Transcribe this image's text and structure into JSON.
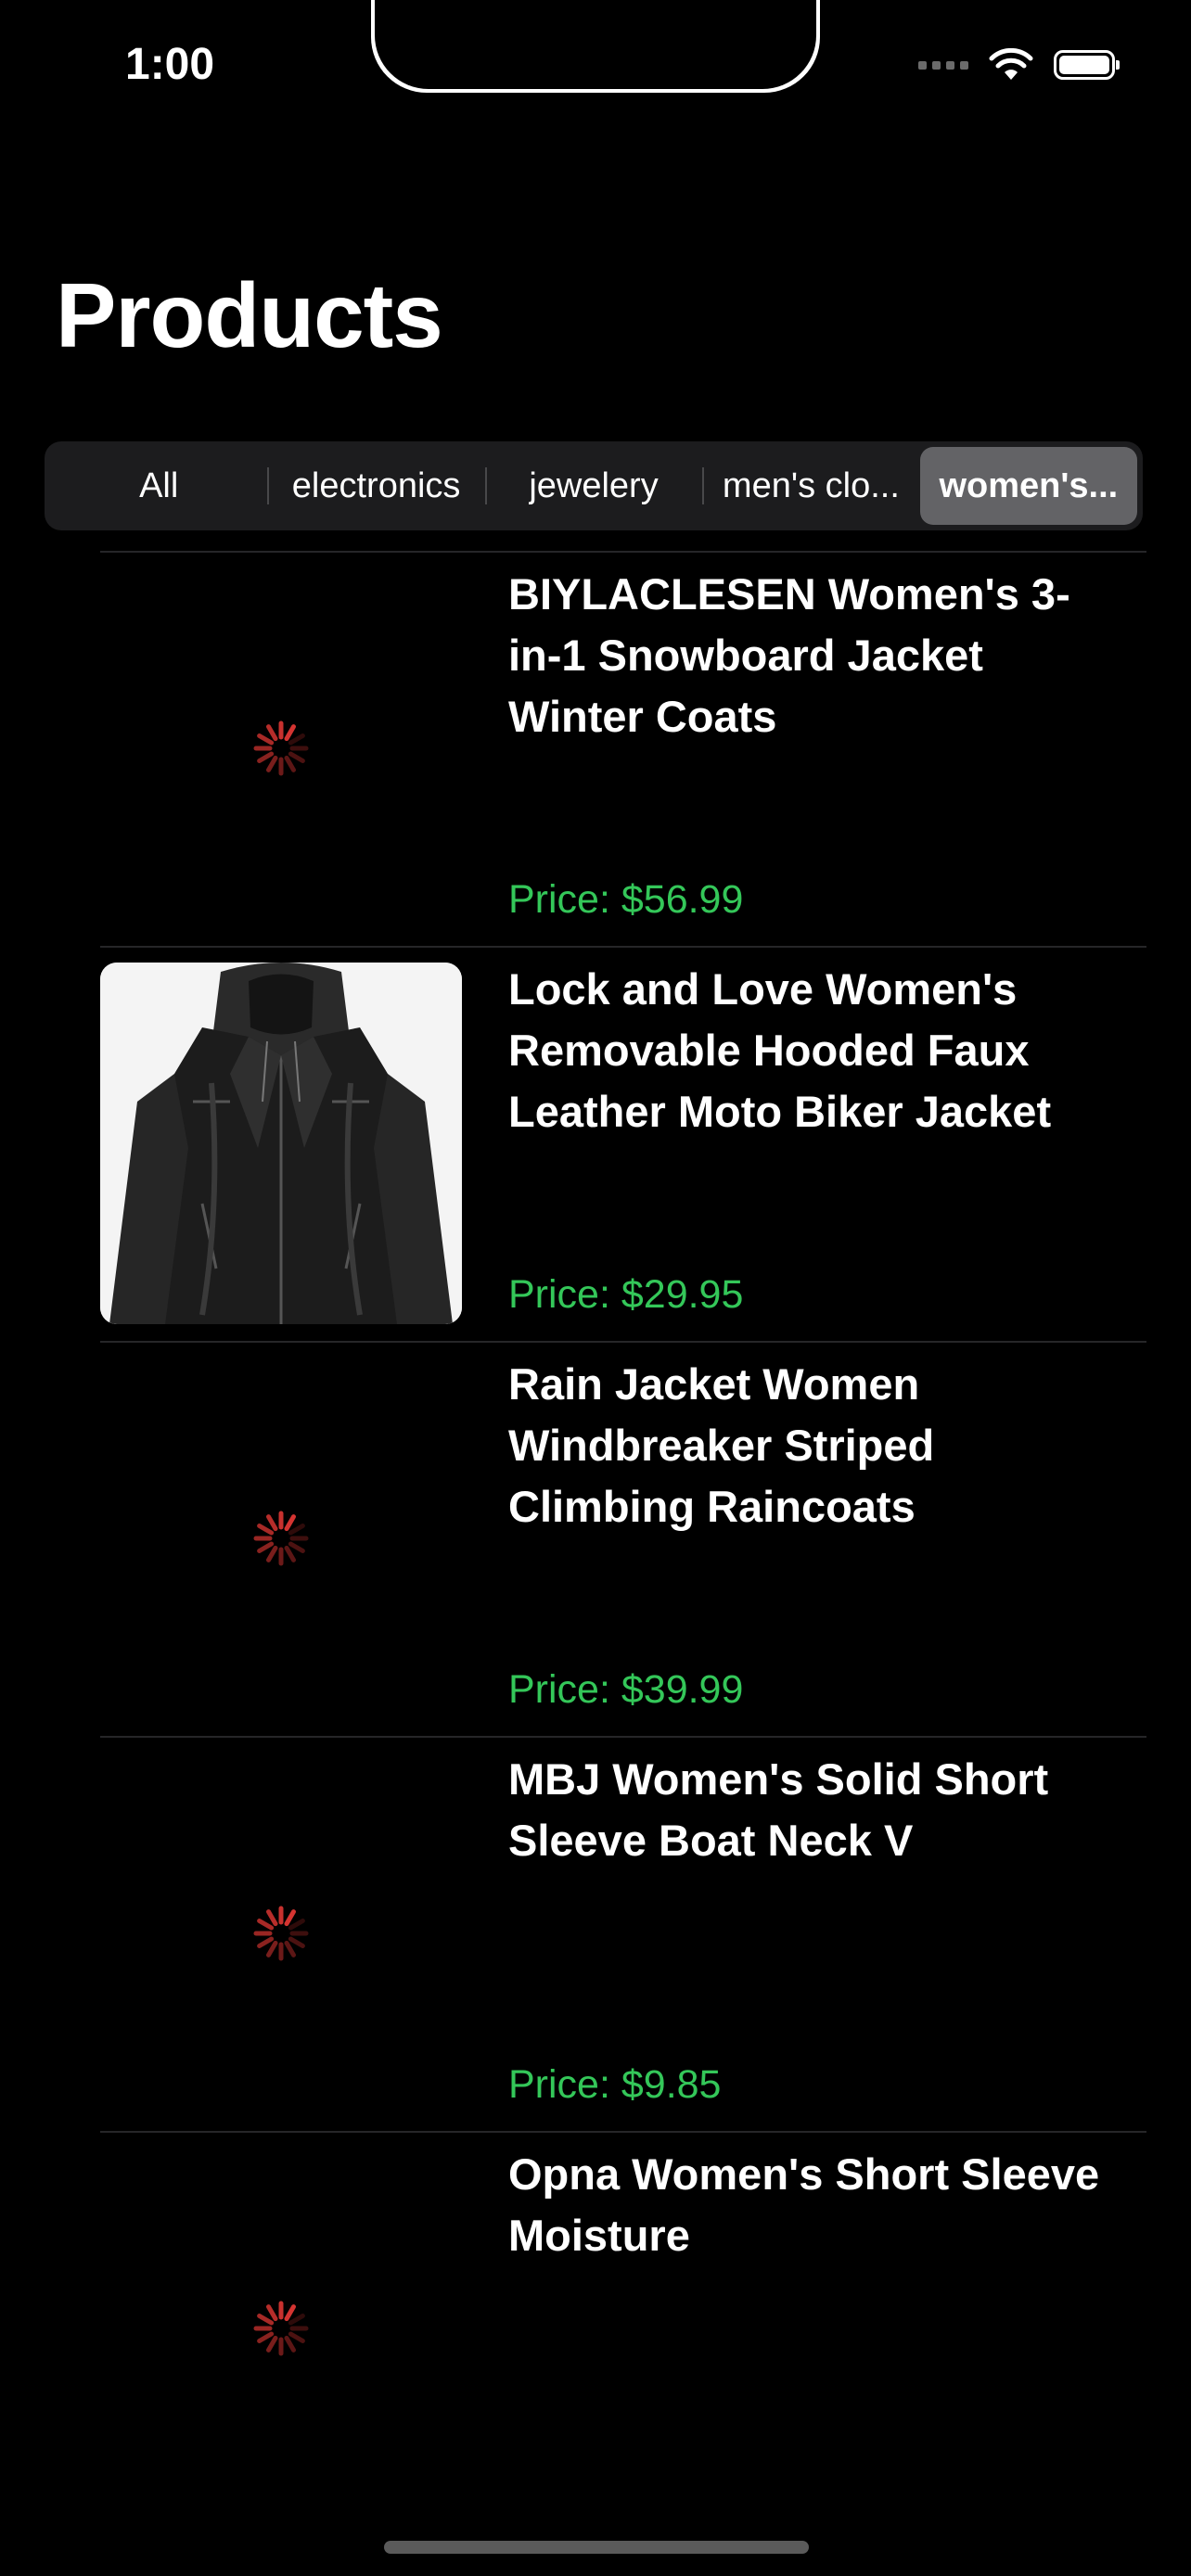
{
  "status_bar": {
    "time": "1:00"
  },
  "header": {
    "title": "Products"
  },
  "categories": {
    "selected_index": 4,
    "items": [
      {
        "label": "All"
      },
      {
        "label": "electronics"
      },
      {
        "label": "jewelery"
      },
      {
        "label": "men's clo..."
      },
      {
        "label": "women's..."
      }
    ]
  },
  "products": [
    {
      "title": "BIYLACLESEN Women's 3-in-1 Snowboard Jacket Winter Coats",
      "price": "Price: $56.99",
      "image": "loading-spinner"
    },
    {
      "title": "Lock and Love Women's Removable Hooded Faux Leather Moto Biker Jacket",
      "price": "Price: $29.95",
      "image": "black-leather-jacket"
    },
    {
      "title": "Rain Jacket Women Windbreaker Striped Climbing Raincoats",
      "price": "Price: $39.99",
      "image": "loading-spinner"
    },
    {
      "title": "MBJ Women's Solid Short Sleeve Boat Neck V",
      "price": "Price: $9.85",
      "image": "loading-spinner"
    },
    {
      "title": "Opna Women's Short Sleeve Moisture",
      "price": "",
      "image": "loading-spinner"
    }
  ],
  "colors": {
    "price": "#34c759",
    "spinner": "#e53935",
    "segment_selected": "#636366"
  }
}
